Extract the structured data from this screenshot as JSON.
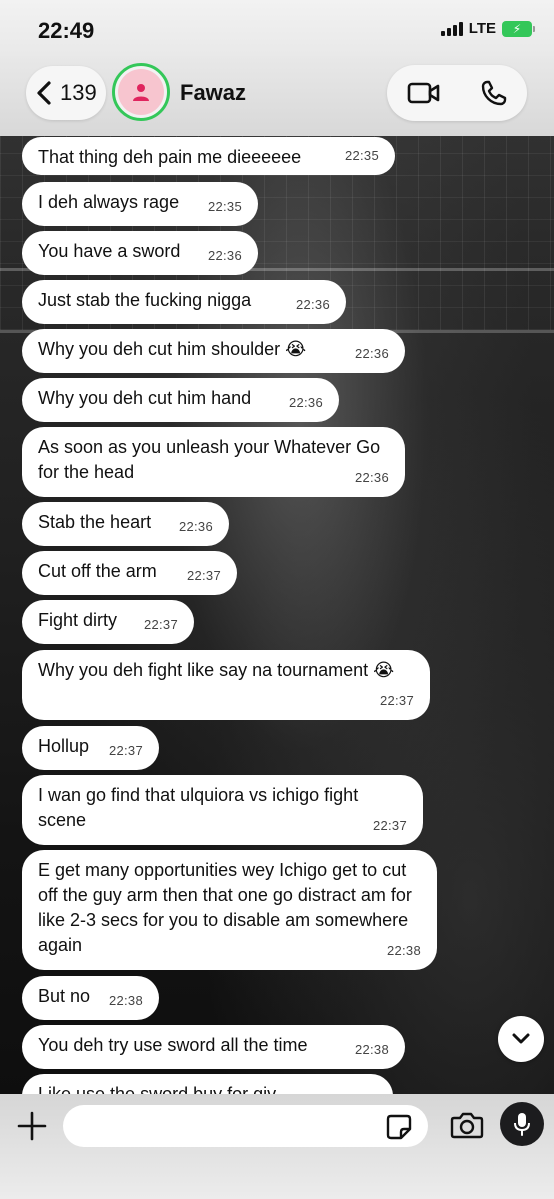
{
  "status_bar": {
    "time": "22:49",
    "network": "LTE",
    "battery_color": "#34c759"
  },
  "header": {
    "back_count": "139",
    "contact_name": "Fawaz",
    "avatar_ring_color": "#34c759",
    "avatar_icon": "person-icon",
    "video_icon": "video-camera-icon",
    "phone_icon": "phone-icon"
  },
  "messages": [
    {
      "text": "That thing deh pain me dieeeeee",
      "time": "22:35"
    },
    {
      "text": "I deh always rage",
      "time": "22:35"
    },
    {
      "text": "You have a sword",
      "time": "22:36"
    },
    {
      "text": "Just stab the fucking nigga",
      "time": "22:36"
    },
    {
      "text": "Why you deh cut him shoulder 😭",
      "time": "22:36"
    },
    {
      "text": "Why you deh cut him hand",
      "time": "22:36"
    },
    {
      "text": "As soon as you unleash your Whatever Go for the head",
      "time": "22:36"
    },
    {
      "text": "Stab the heart",
      "time": "22:36"
    },
    {
      "text": "Cut off the arm",
      "time": "22:37"
    },
    {
      "text": "Fight dirty",
      "time": "22:37"
    },
    {
      "text": "Why you deh fight like say na tournament 😭",
      "time": "22:37"
    },
    {
      "text": "Hollup",
      "time": "22:37"
    },
    {
      "text": "I wan go find that ulquiora vs ichigo fight scene",
      "time": "22:37"
    },
    {
      "text": "E get many opportunities wey Ichigo get to cut off the guy arm  then that one go distract am  for like 2-3 secs for you to disable am somewhere again",
      "time": "22:38"
    },
    {
      "text": "But no",
      "time": "22:38"
    },
    {
      "text": "You deh try use sword all the time",
      "time": "22:38"
    },
    {
      "text": "Like use the sword buy for giv",
      "time": ""
    }
  ],
  "composer": {
    "placeholder": "",
    "value": ""
  }
}
